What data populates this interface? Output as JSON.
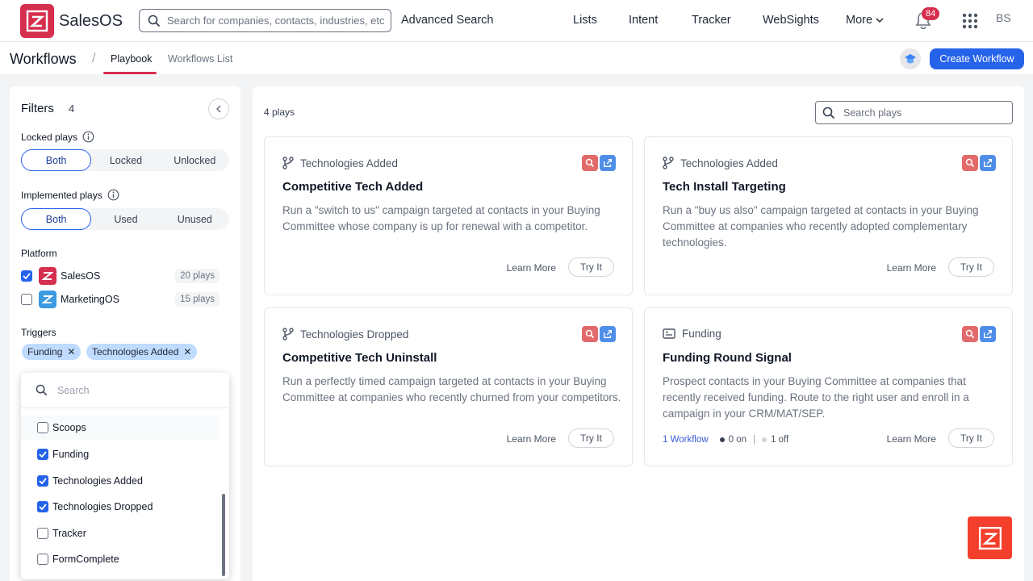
{
  "nav": {
    "brand": "SalesOS",
    "search_placeholder": "Search for companies, contacts, industries, etc.",
    "advanced_search": "Advanced Search",
    "items": [
      "Lists",
      "Intent",
      "Tracker",
      "WebSights",
      "More"
    ],
    "notifications": "84",
    "avatar": "BS"
  },
  "subheader": {
    "title": "Workflows",
    "separator": "/",
    "tabs": [
      {
        "label": "Playbook",
        "active": true
      },
      {
        "label": "Workflows List",
        "active": false
      }
    ],
    "create_button": "Create Workflow"
  },
  "filters": {
    "title": "Filters",
    "count": "4",
    "locked": {
      "label": "Locked plays",
      "options": [
        "Both",
        "Locked",
        "Unlocked"
      ],
      "selected": "Both"
    },
    "implemented": {
      "label": "Implemented plays",
      "options": [
        "Both",
        "Used",
        "Unused"
      ],
      "selected": "Both"
    },
    "platform": {
      "label": "Platform",
      "items": [
        {
          "name": "SalesOS",
          "plays": "20 plays",
          "checked": true,
          "color": "#d62e4e"
        },
        {
          "name": "MarketingOS",
          "plays": "15 plays",
          "checked": false,
          "color": "#3b9ae1"
        }
      ]
    },
    "triggers": {
      "label": "Triggers",
      "chips": [
        "Funding",
        "Technologies Added"
      ],
      "dropdown": {
        "search_placeholder": "Search",
        "options": [
          {
            "label": "Scoops",
            "checked": false
          },
          {
            "label": "Funding",
            "checked": true
          },
          {
            "label": "Technologies Added",
            "checked": true
          },
          {
            "label": "Technologies Dropped",
            "checked": true
          },
          {
            "label": "Tracker",
            "checked": false
          },
          {
            "label": "FormComplete",
            "checked": false
          }
        ]
      }
    }
  },
  "plays": {
    "count_label": "4 plays",
    "search_placeholder": "Search plays",
    "learn_more": "Learn More",
    "try_it": "Try It",
    "cards": [
      {
        "trigger": "Technologies Added",
        "trigger_icon": "branch-icon",
        "title": "Competitive Tech Added",
        "description": "Run a \"switch to us\" campaign targeted at contacts in your Buying Committee whose company is up for renewal with a competitor."
      },
      {
        "trigger": "Technologies Added",
        "trigger_icon": "branch-icon",
        "title": "Tech Install Targeting",
        "description": "Run a \"buy us also\" campaign targeted at contacts in your Buying Committee at companies who recently adopted complementary technologies."
      },
      {
        "trigger": "Technologies Dropped",
        "trigger_icon": "branch-icon",
        "title": "Competitive Tech Uninstall",
        "description": "Run a perfectly timed campaign targeted at contacts in your Buying Committee at companies who recently churned from your competitors."
      },
      {
        "trigger": "Funding",
        "trigger_icon": "money-icon",
        "title": "Funding Round Signal",
        "description": "Prospect contacts in your Buying Committee at companies that recently received funding. Route to the right user and enroll in a campaign in your CRM/MAT/SEP.",
        "workflows": "1 Workflow",
        "on": "0 on",
        "off": "1 off",
        "divider": "|"
      }
    ]
  },
  "colors": {
    "brand": "#d62e4e",
    "primary": "#2563eb",
    "chip": "#bfdbfe",
    "fab": "#f43f2c"
  }
}
